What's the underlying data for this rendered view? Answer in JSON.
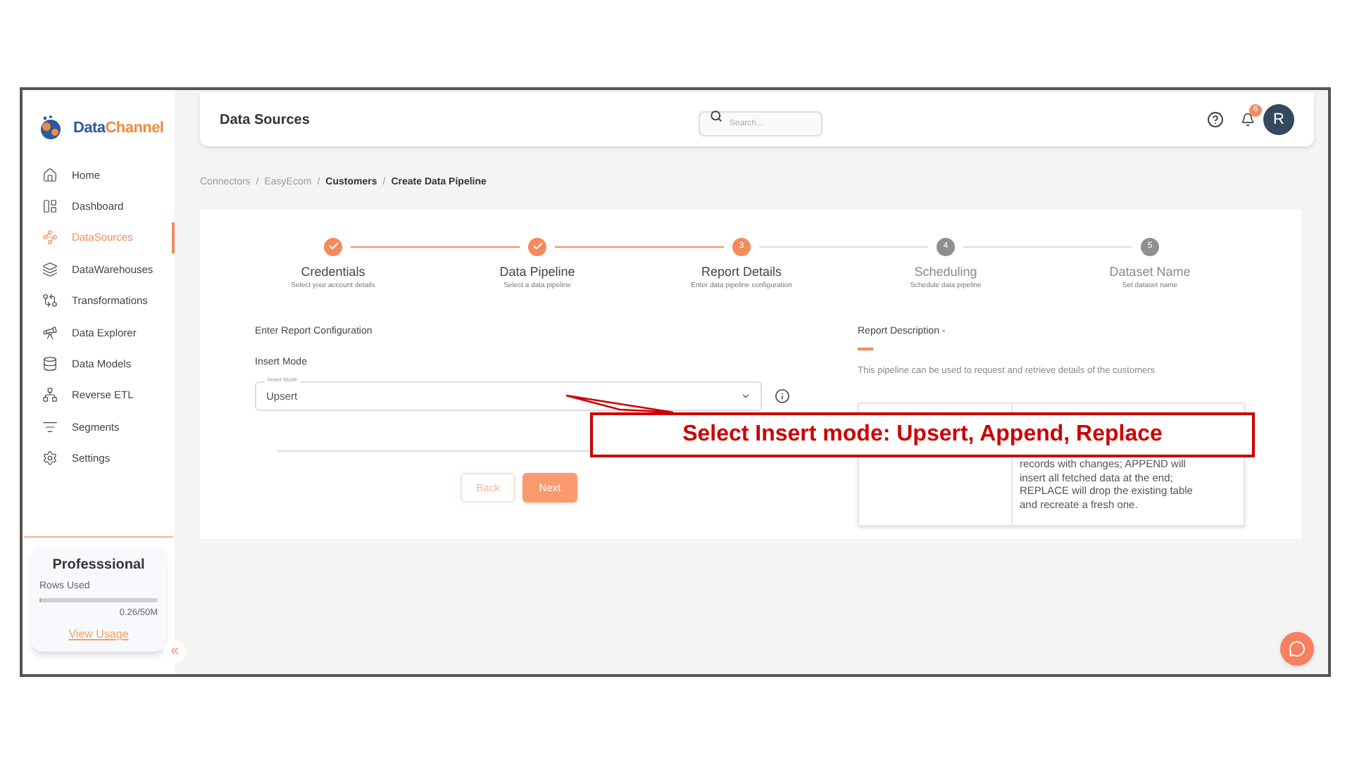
{
  "brand": {
    "name_part_1": "Data",
    "name_part_2": "Channel"
  },
  "sidebar": {
    "items": [
      {
        "label": "Home",
        "selected": false
      },
      {
        "label": "Dashboard",
        "selected": false
      },
      {
        "label": "DataSources",
        "selected": true
      },
      {
        "label": "DataWarehouses",
        "selected": false
      },
      {
        "label": "Transformations",
        "selected": false
      },
      {
        "label": "Data Explorer",
        "selected": false
      },
      {
        "label": "Data Models",
        "selected": false
      },
      {
        "label": "Reverse ETL",
        "selected": false
      },
      {
        "label": "Segments",
        "selected": false
      },
      {
        "label": "Settings",
        "selected": false
      }
    ],
    "plan": {
      "title": "Professsional",
      "rows_label": "Rows Used",
      "level": 0.01,
      "usage": "0.26/50M",
      "link": "View Usage"
    },
    "collapse": "«"
  },
  "header": {
    "title": "Data Sources",
    "search_placeholder": "Search...",
    "notifications": "6",
    "avatar": "R"
  },
  "breadcrumb": [
    {
      "kind": "link",
      "label": "Connectors"
    },
    {
      "kind": "separator",
      "label": "/"
    },
    {
      "kind": "link",
      "label": "EasyEcom"
    },
    {
      "kind": "separator",
      "label": "/"
    },
    {
      "kind": "current",
      "label": "Customers"
    },
    {
      "kind": "separator",
      "label": "/"
    },
    {
      "kind": "current",
      "label": "Create Data Pipeline"
    }
  ],
  "steps": [
    {
      "label": "Credentials",
      "hint": "Select your account details",
      "kind": "done"
    },
    {
      "label": "Data Pipeline",
      "hint": "Select a data pipeline",
      "kind": "done"
    },
    {
      "label": "Report Details",
      "hint": "Enter data pipeline configuration",
      "kind": "current",
      "number": "3"
    },
    {
      "label": "Scheduling",
      "hint": "Schedule data pipeline",
      "kind": "upcoming",
      "number": "4"
    },
    {
      "label": "Dataset Name",
      "hint": "Set dataset name",
      "kind": "upcoming",
      "number": "5"
    }
  ],
  "form": {
    "heading": "Enter Report Configuration",
    "field_label": "Insert Mode",
    "select": {
      "floating_label": "Insert Mode",
      "value": "Upsert"
    },
    "buttons": [
      {
        "label": "Back",
        "kind": "outline"
      },
      {
        "label": "Next",
        "kind": "primary"
      }
    ]
  },
  "description": {
    "title": "Report Description -",
    "text": "This pipeline can be used to request and retrieve details of the customers",
    "table": {
      "column_2_text": "records with changes; APPEND will insert all fetched data at the end; REPLACE will drop the existing table and recreate a fresh one."
    }
  },
  "callout": {
    "text": "Select Insert mode: Upsert, Append, Replace"
  }
}
